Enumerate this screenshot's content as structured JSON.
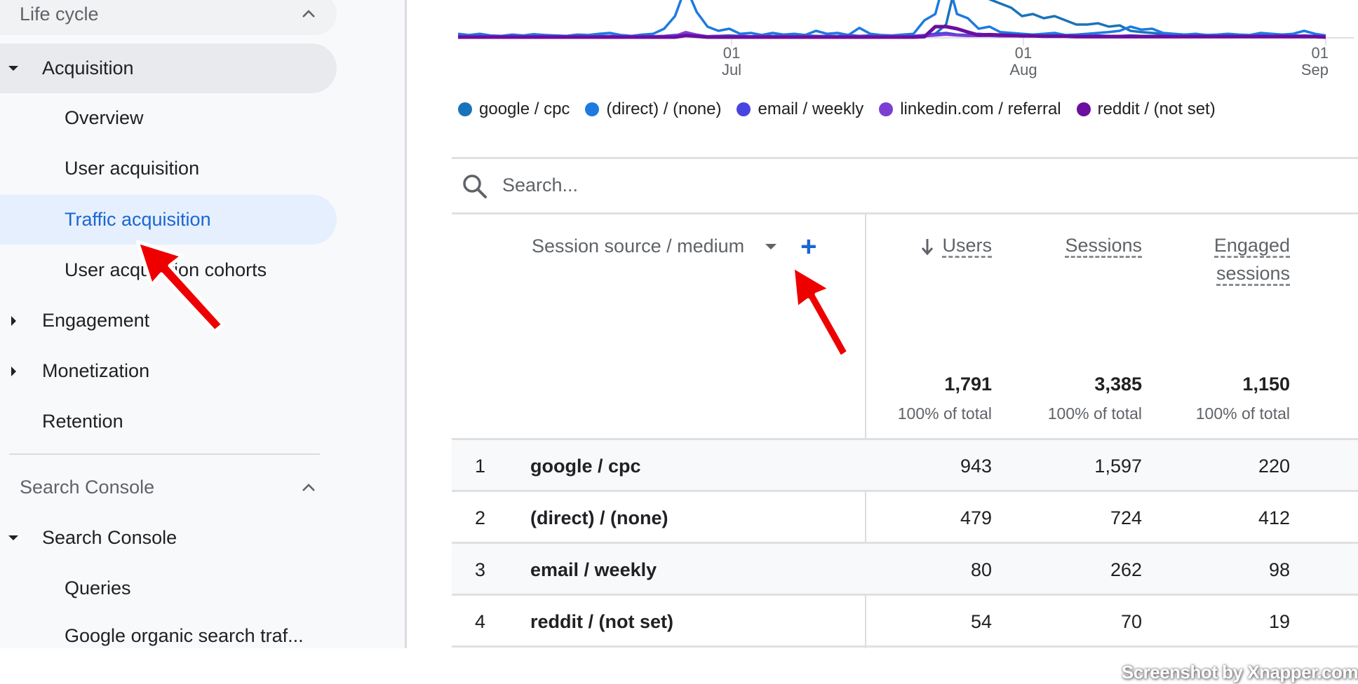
{
  "sidebar": {
    "sections": [
      {
        "label": "Life cycle",
        "icon": "chevron-up-icon"
      },
      {
        "label": "Search Console",
        "icon": "chevron-up-icon"
      }
    ],
    "items": [
      {
        "label": "Acquisition",
        "level": 1,
        "icon": "caret-down-icon",
        "state": "expanded"
      },
      {
        "label": "Overview",
        "level": 2
      },
      {
        "label": "User acquisition",
        "level": 2
      },
      {
        "label": "Traffic acquisition",
        "level": 2,
        "state": "active"
      },
      {
        "label": "User acquisition cohorts",
        "level": 2
      },
      {
        "label": "Engagement",
        "level": 1,
        "icon": "caret-right-icon",
        "state": "collapsed"
      },
      {
        "label": "Monetization",
        "level": 1,
        "icon": "caret-right-icon",
        "state": "collapsed"
      },
      {
        "label": "Retention",
        "level": 1
      },
      {
        "label": "Search Console",
        "level": 1,
        "icon": "caret-down-icon",
        "state": "expanded"
      },
      {
        "label": "Queries",
        "level": 2
      },
      {
        "label": "Google organic search traf...",
        "level": 2
      }
    ]
  },
  "chart_data": {
    "type": "line",
    "title": "",
    "xlabel": "",
    "ylabel": "",
    "x_ticks": [
      {
        "day": "01",
        "month": "Jul"
      },
      {
        "day": "01",
        "month": "Aug"
      },
      {
        "day": "01",
        "month": "Sep"
      }
    ],
    "x_range_days": [
      0,
      80
    ],
    "tick_day_index": [
      30,
      61,
      92
    ],
    "y_visible_range": [
      0,
      1
    ],
    "note": "Top of chart cropped; values are relative (fraction of visible plot height) estimated from pixels",
    "series": [
      {
        "name": "google / cpc",
        "color": "#1a73b8",
        "values": [
          0.05,
          0.03,
          0.04,
          0.02,
          0.03,
          0.02,
          0.02,
          0.03,
          0.02,
          0.02,
          0.03,
          0.02,
          0.02,
          0.03,
          0.02,
          0.02,
          0.03,
          0.03,
          0.02,
          0.02,
          0.03,
          0.03,
          0.02,
          0.02,
          0.03,
          0.04,
          0.03,
          0.02,
          0.03,
          0.03,
          0.02,
          0.03,
          0.04,
          0.03,
          0.02,
          0.03,
          0.05,
          0.03,
          0.04,
          0.02,
          0.03,
          0.05,
          0.02,
          0.04,
          0.08,
          0.3,
          1.4,
          1.5,
          1.2,
          0.9,
          0.8,
          0.7,
          0.5,
          0.55,
          0.45,
          0.5,
          0.4,
          0.3,
          0.3,
          0.33,
          0.25,
          0.28,
          0.15,
          0.12,
          0.1,
          0.08,
          0.07,
          0.06,
          0.05,
          0.05,
          0.04,
          0.05,
          0.04,
          0.03,
          0.04,
          0.03,
          0.03,
          0.04,
          0.03,
          0.03,
          0.02
        ]
      },
      {
        "name": "(direct) / (none)",
        "color": "#1e7ae0",
        "values": [
          0.08,
          0.05,
          0.08,
          0.04,
          0.03,
          0.06,
          0.04,
          0.07,
          0.05,
          0.04,
          0.03,
          0.06,
          0.05,
          0.08,
          0.1,
          0.05,
          0.03,
          0.06,
          0.08,
          0.2,
          0.5,
          1.2,
          0.6,
          0.25,
          0.15,
          0.2,
          0.08,
          0.1,
          0.05,
          0.1,
          0.06,
          0.08,
          0.05,
          0.15,
          0.08,
          0.1,
          0.05,
          0.22,
          0.08,
          0.05,
          0.04,
          0.06,
          0.08,
          0.4,
          0.55,
          1.5,
          0.55,
          0.45,
          0.2,
          0.25,
          0.12,
          0.1,
          0.08,
          0.06,
          0.08,
          0.1,
          0.05,
          0.06,
          0.08,
          0.1,
          0.12,
          0.15,
          0.25,
          0.18,
          0.2,
          0.1,
          0.08,
          0.06,
          0.08,
          0.05,
          0.06,
          0.08,
          0.06,
          0.05,
          0.1,
          0.08,
          0.06,
          0.08,
          0.15,
          0.08,
          0.04
        ]
      },
      {
        "name": "email / weekly",
        "color": "#4745e0",
        "values": [
          0.03,
          0.02,
          0.03,
          0.02,
          0.02,
          0.03,
          0.02,
          0.02,
          0.03,
          0.02,
          0.02,
          0.03,
          0.02,
          0.02,
          0.03,
          0.02,
          0.02,
          0.03,
          0.02,
          0.03,
          0.05,
          0.06,
          0.04,
          0.02,
          0.03,
          0.02,
          0.03,
          0.02,
          0.03,
          0.02,
          0.03,
          0.02,
          0.03,
          0.02,
          0.03,
          0.02,
          0.03,
          0.02,
          0.03,
          0.02,
          0.03,
          0.02,
          0.03,
          0.05,
          0.08,
          0.1,
          0.06,
          0.05,
          0.08,
          0.06,
          0.05,
          0.04,
          0.05,
          0.04,
          0.03,
          0.04,
          0.03,
          0.04,
          0.03,
          0.04,
          0.03,
          0.03,
          0.04,
          0.03,
          0.03,
          0.04,
          0.03,
          0.03,
          0.04,
          0.03,
          0.03,
          0.04,
          0.03,
          0.03,
          0.04,
          0.03,
          0.05,
          0.03,
          0.04,
          0.03,
          0.02
        ]
      },
      {
        "name": "linkedin.com / referral",
        "color": "#7b3fd4",
        "values": [
          0.02,
          0.02,
          0.02,
          0.02,
          0.02,
          0.02,
          0.02,
          0.02,
          0.02,
          0.02,
          0.02,
          0.02,
          0.02,
          0.02,
          0.02,
          0.02,
          0.02,
          0.02,
          0.02,
          0.02,
          0.03,
          0.12,
          0.06,
          0.02,
          0.02,
          0.02,
          0.02,
          0.02,
          0.02,
          0.02,
          0.02,
          0.02,
          0.02,
          0.02,
          0.02,
          0.02,
          0.02,
          0.02,
          0.02,
          0.02,
          0.02,
          0.02,
          0.02,
          0.02,
          0.04,
          0.06,
          0.04,
          0.03,
          0.03,
          0.03,
          0.02,
          0.02,
          0.02,
          0.02,
          0.02,
          0.02,
          0.02,
          0.02,
          0.02,
          0.02,
          0.02,
          0.02,
          0.02,
          0.02,
          0.02,
          0.02,
          0.02,
          0.02,
          0.02,
          0.02,
          0.02,
          0.02,
          0.02,
          0.02,
          0.02,
          0.02,
          0.02,
          0.02,
          0.02,
          0.02,
          0.02
        ]
      },
      {
        "name": "reddit / (not set)",
        "color": "#6a0f9e",
        "values": [
          0,
          0,
          0,
          0,
          0,
          0,
          0,
          0,
          0,
          0,
          0,
          0,
          0,
          0,
          0,
          0,
          0,
          0,
          0,
          0,
          0,
          0.04,
          0.02,
          0,
          0,
          0,
          0,
          0,
          0,
          0,
          0,
          0,
          0,
          0,
          0,
          0,
          0,
          0,
          0,
          0,
          0,
          0,
          0,
          0.01,
          0.25,
          0.25,
          0.2,
          0.12,
          0.05,
          0.06,
          0.05,
          0.04,
          0.03,
          0.03,
          0.02,
          0.02,
          0.02,
          0.01,
          0.01,
          0.01,
          0.01,
          0.01,
          0.01,
          0.01,
          0.01,
          0.01,
          0.01,
          0.01,
          0.01,
          0.01,
          0.01,
          0.01,
          0.01,
          0.01,
          0.01,
          0.01,
          0.01,
          0.01,
          0.01,
          0.01,
          0
        ]
      }
    ]
  },
  "search": {
    "placeholder": "Search..."
  },
  "table": {
    "dimension_header": "Session source / medium",
    "add_dimension_label": "+",
    "columns": [
      {
        "label_line1": "Users",
        "label_line2": "",
        "sorted": "descending"
      },
      {
        "label_line1": "Sessions",
        "label_line2": ""
      },
      {
        "label_line1": "Engaged",
        "label_line2": "sessions"
      }
    ],
    "totals": [
      {
        "value": "1,791",
        "pct": "100% of total"
      },
      {
        "value": "3,385",
        "pct": "100% of total"
      },
      {
        "value": "1,150",
        "pct": "100% of total"
      }
    ],
    "rows": [
      {
        "index": "1",
        "dimension": "google / cpc",
        "values": [
          "943",
          "1,597",
          "220"
        ]
      },
      {
        "index": "2",
        "dimension": "(direct) / (none)",
        "values": [
          "479",
          "724",
          "412"
        ]
      },
      {
        "index": "3",
        "dimension": "email / weekly",
        "values": [
          "80",
          "262",
          "98"
        ]
      },
      {
        "index": "4",
        "dimension": "reddit / (not set)",
        "values": [
          "54",
          "70",
          "19"
        ]
      }
    ]
  },
  "annotations": {
    "arrow_color": "#ee0000",
    "watermark": "Screenshot by Xnapper.com"
  }
}
